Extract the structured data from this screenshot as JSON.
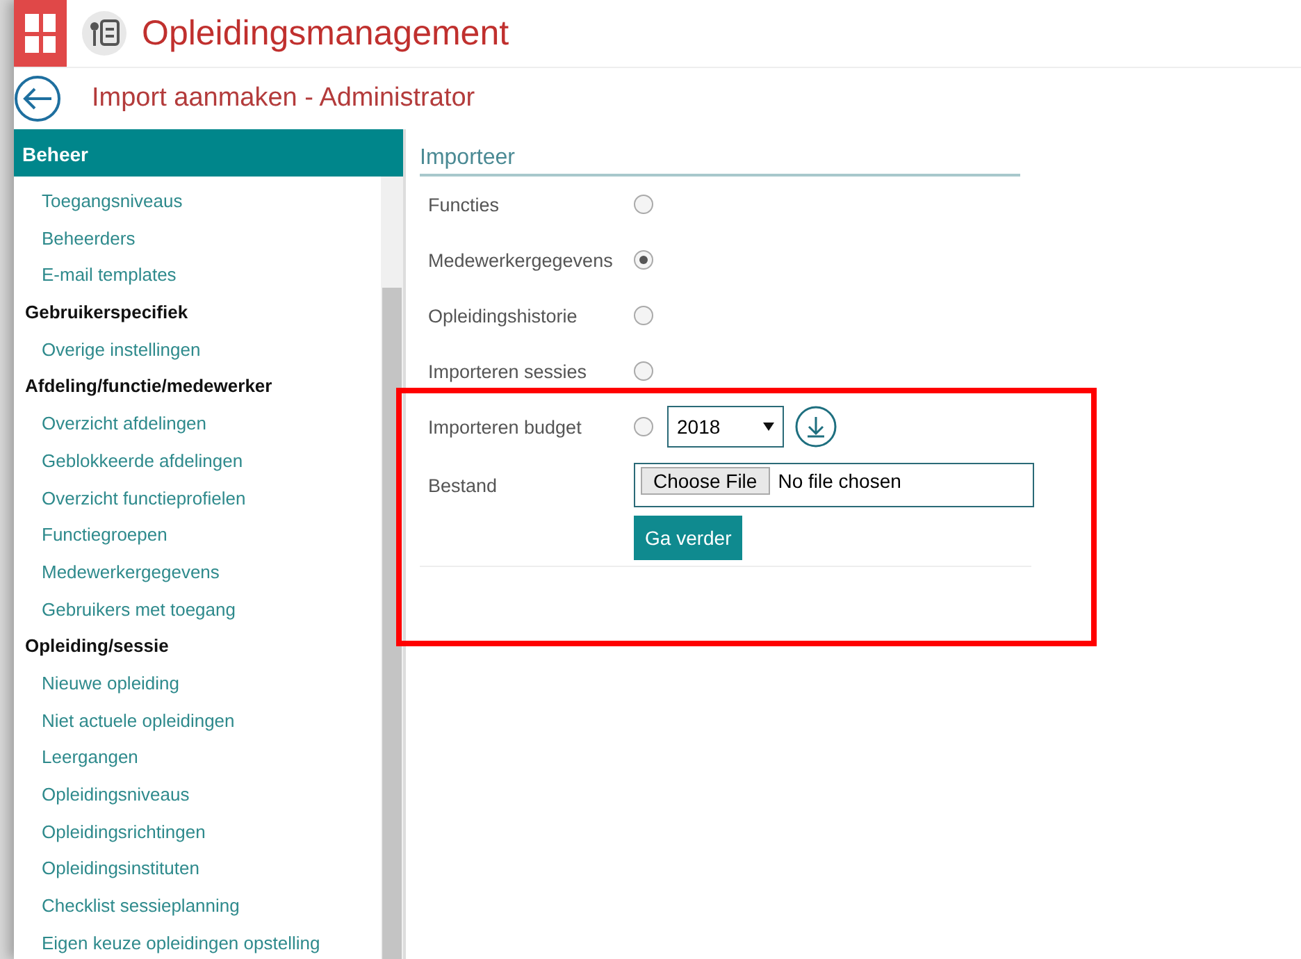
{
  "app": {
    "title": "Opleidingsmanagement"
  },
  "page": {
    "title": "Import aanmaken - Administrator"
  },
  "sidebar": {
    "title": "Beheer",
    "items": [
      {
        "kind": "link",
        "label": "Toegangsniveaus"
      },
      {
        "kind": "link",
        "label": "Beheerders"
      },
      {
        "kind": "link",
        "label": "E-mail templates"
      },
      {
        "kind": "heading",
        "label": "Gebruikerspecifiek"
      },
      {
        "kind": "link",
        "label": "Overige instellingen"
      },
      {
        "kind": "heading",
        "label": "Afdeling/functie/medewerker"
      },
      {
        "kind": "link",
        "label": "Overzicht afdelingen"
      },
      {
        "kind": "link",
        "label": "Geblokkeerde afdelingen"
      },
      {
        "kind": "link",
        "label": "Overzicht functieprofielen"
      },
      {
        "kind": "link",
        "label": "Functiegroepen"
      },
      {
        "kind": "link",
        "label": "Medewerkergegevens"
      },
      {
        "kind": "link",
        "label": "Gebruikers met toegang"
      },
      {
        "kind": "heading",
        "label": "Opleiding/sessie"
      },
      {
        "kind": "link",
        "label": "Nieuwe opleiding"
      },
      {
        "kind": "link",
        "label": "Niet actuele opleidingen"
      },
      {
        "kind": "link",
        "label": "Leergangen"
      },
      {
        "kind": "link",
        "label": "Opleidingsniveaus"
      },
      {
        "kind": "link",
        "label": "Opleidingsrichtingen"
      },
      {
        "kind": "link",
        "label": "Opleidingsinstituten"
      },
      {
        "kind": "link",
        "label": "Checklist sessieplanning"
      },
      {
        "kind": "link",
        "label": "Eigen keuze opleidingen opstelling"
      }
    ]
  },
  "form": {
    "title": "Importeer",
    "options": [
      {
        "label": "Functies",
        "selected": false
      },
      {
        "label": "Medewerkergegevens",
        "selected": true
      },
      {
        "label": "Opleidingshistorie",
        "selected": false
      },
      {
        "label": "Importeren sessies",
        "selected": false
      },
      {
        "label": "Importeren budget",
        "selected": false,
        "year": "2018"
      }
    ],
    "file": {
      "label": "Bestand",
      "button": "Choose File",
      "status": "No file chosen"
    },
    "submit": "Ga verder"
  }
}
